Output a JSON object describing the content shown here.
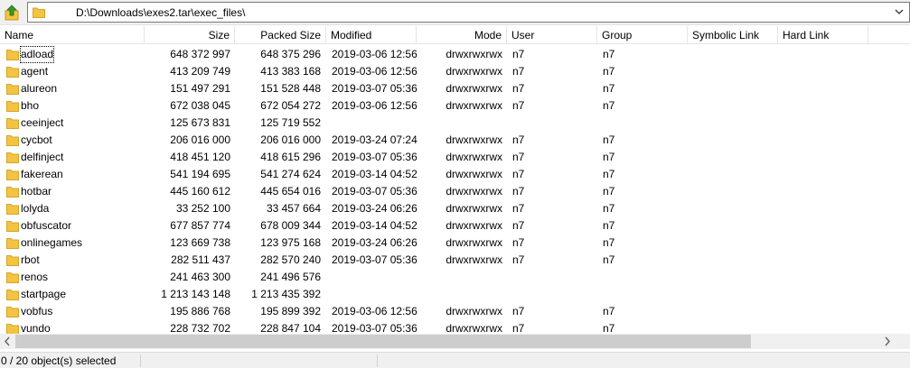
{
  "address_bar": {
    "path": "D:\\Downloads\\exes2.tar\\exec_files\\"
  },
  "columns": {
    "name": "Name",
    "size": "Size",
    "packed_size": "Packed Size",
    "modified": "Modified",
    "mode": "Mode",
    "user": "User",
    "group": "Group",
    "symbolic_link": "Symbolic Link",
    "hard_link": "Hard Link"
  },
  "files": [
    {
      "name": "adload",
      "size": "648 372 997",
      "packed": "648 375 296",
      "modified": "2019-03-06 12:56",
      "mode": "drwxrwxrwx",
      "user": "n7",
      "group": "n7"
    },
    {
      "name": "agent",
      "size": "413 209 749",
      "packed": "413 383 168",
      "modified": "2019-03-06 12:56",
      "mode": "drwxrwxrwx",
      "user": "n7",
      "group": "n7"
    },
    {
      "name": "alureon",
      "size": "151 497 291",
      "packed": "151 528 448",
      "modified": "2019-03-07 05:36",
      "mode": "drwxrwxrwx",
      "user": "n7",
      "group": "n7"
    },
    {
      "name": "bho",
      "size": "672 038 045",
      "packed": "672 054 272",
      "modified": "2019-03-06 12:56",
      "mode": "drwxrwxrwx",
      "user": "n7",
      "group": "n7"
    },
    {
      "name": "ceeinject",
      "size": "125 673 831",
      "packed": "125 719 552",
      "modified": "",
      "mode": "",
      "user": "",
      "group": ""
    },
    {
      "name": "cycbot",
      "size": "206 016 000",
      "packed": "206 016 000",
      "modified": "2019-03-24 07:24",
      "mode": "drwxrwxrwx",
      "user": "n7",
      "group": "n7"
    },
    {
      "name": "delfinject",
      "size": "418 451 120",
      "packed": "418 615 296",
      "modified": "2019-03-07 05:36",
      "mode": "drwxrwxrwx",
      "user": "n7",
      "group": "n7"
    },
    {
      "name": "fakerean",
      "size": "541 194 695",
      "packed": "541 274 624",
      "modified": "2019-03-14 04:52",
      "mode": "drwxrwxrwx",
      "user": "n7",
      "group": "n7"
    },
    {
      "name": "hotbar",
      "size": "445 160 612",
      "packed": "445 654 016",
      "modified": "2019-03-07 05:36",
      "mode": "drwxrwxrwx",
      "user": "n7",
      "group": "n7"
    },
    {
      "name": "lolyda",
      "size": "33 252 100",
      "packed": "33 457 664",
      "modified": "2019-03-24 06:26",
      "mode": "drwxrwxrwx",
      "user": "n7",
      "group": "n7"
    },
    {
      "name": "obfuscator",
      "size": "677 857 774",
      "packed": "678 009 344",
      "modified": "2019-03-14 04:52",
      "mode": "drwxrwxrwx",
      "user": "n7",
      "group": "n7"
    },
    {
      "name": "onlinegames",
      "size": "123 669 738",
      "packed": "123 975 168",
      "modified": "2019-03-24 06:26",
      "mode": "drwxrwxrwx",
      "user": "n7",
      "group": "n7"
    },
    {
      "name": "rbot",
      "size": "282 511 437",
      "packed": "282 570 240",
      "modified": "2019-03-07 05:36",
      "mode": "drwxrwxrwx",
      "user": "n7",
      "group": "n7"
    },
    {
      "name": "renos",
      "size": "241 463 300",
      "packed": "241 496 576",
      "modified": "",
      "mode": "",
      "user": "",
      "group": ""
    },
    {
      "name": "startpage",
      "size": "1 213 143 148",
      "packed": "1 213 435 392",
      "modified": "",
      "mode": "",
      "user": "",
      "group": ""
    },
    {
      "name": "vobfus",
      "size": "195 886 768",
      "packed": "195 899 392",
      "modified": "2019-03-06 12:56",
      "mode": "drwxrwxrwx",
      "user": "n7",
      "group": "n7"
    },
    {
      "name": "vundo",
      "size": "228 732 702",
      "packed": "228 847 104",
      "modified": "2019-03-07 05:36",
      "mode": "drwxrwxrwx",
      "user": "n7",
      "group": "n7"
    }
  ],
  "status": {
    "selection": "0 / 20 object(s) selected"
  },
  "colors": {
    "folder": "#f5c342",
    "up_arrow": "#3a9a2a"
  }
}
